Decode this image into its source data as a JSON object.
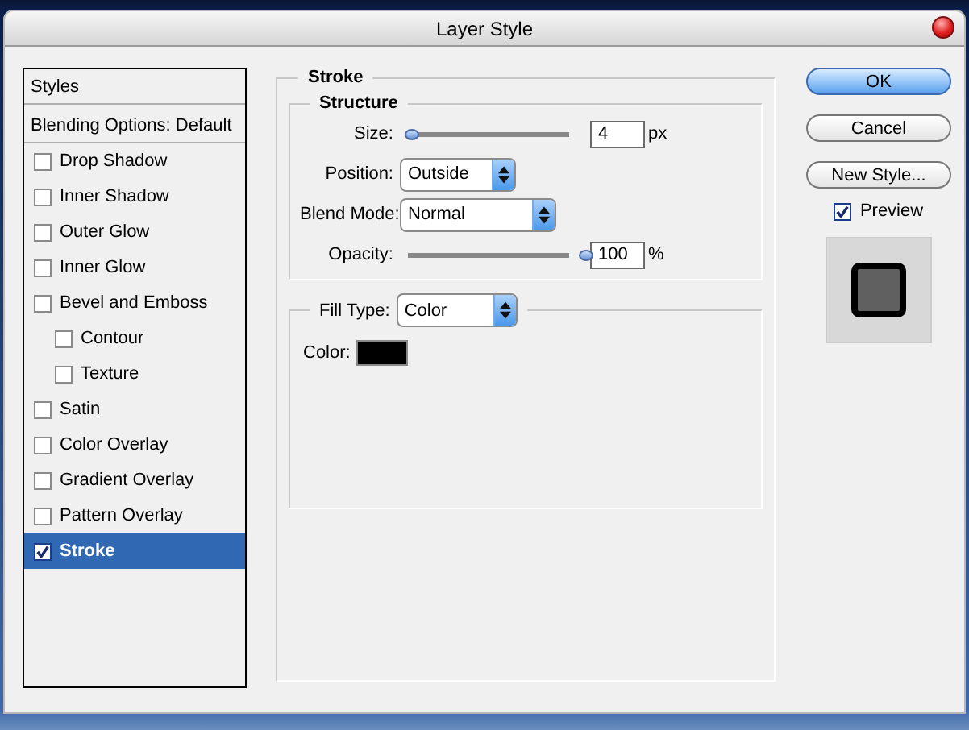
{
  "window": {
    "title": "Layer Style"
  },
  "styles": [
    {
      "label": "Styles",
      "kind": "header",
      "selected": false
    },
    {
      "label": "Blending Options: Default",
      "kind": "header",
      "selected": false
    },
    {
      "label": "Drop Shadow",
      "kind": "effect",
      "checked": false,
      "selected": false
    },
    {
      "label": "Inner Shadow",
      "kind": "effect",
      "checked": false,
      "selected": false
    },
    {
      "label": "Outer Glow",
      "kind": "effect",
      "checked": false,
      "selected": false
    },
    {
      "label": "Inner Glow",
      "kind": "effect",
      "checked": false,
      "selected": false
    },
    {
      "label": "Bevel and Emboss",
      "kind": "effect",
      "checked": false,
      "selected": false,
      "children": [
        {
          "label": "Contour",
          "kind": "effect",
          "checked": false,
          "selected": false
        },
        {
          "label": "Texture",
          "kind": "effect",
          "checked": false,
          "selected": false
        }
      ]
    },
    {
      "label": "Satin",
      "kind": "effect",
      "checked": false,
      "selected": false
    },
    {
      "label": "Color Overlay",
      "kind": "effect",
      "checked": false,
      "selected": false
    },
    {
      "label": "Gradient Overlay",
      "kind": "effect",
      "checked": false,
      "selected": false
    },
    {
      "label": "Pattern Overlay",
      "kind": "effect",
      "checked": false,
      "selected": false
    },
    {
      "label": "Stroke",
      "kind": "effect",
      "checked": true,
      "selected": true
    }
  ],
  "panel": {
    "title": "Stroke",
    "structure": {
      "title": "Structure",
      "rows": [
        {
          "kind": "slider",
          "label": "Size:",
          "level": 0.02,
          "value": "4",
          "unit": "px"
        },
        {
          "kind": "dropdown",
          "label": "Position:",
          "value": "Outside"
        },
        {
          "kind": "dropdown",
          "label": "Blend Mode:",
          "value": "Normal"
        },
        {
          "kind": "slider",
          "label": "Opacity:",
          "level": 1,
          "value": "100",
          "unit": "%"
        }
      ]
    },
    "fill": {
      "label": "Fill Type:",
      "value": "Color",
      "color_label": "Color:",
      "color": "#000000"
    }
  },
  "buttons": [
    {
      "label": "OK",
      "default": true
    },
    {
      "label": "Cancel",
      "default": false
    },
    {
      "label": "New Style...",
      "default": false
    }
  ],
  "preview": {
    "label": "Preview",
    "checked": true
  }
}
